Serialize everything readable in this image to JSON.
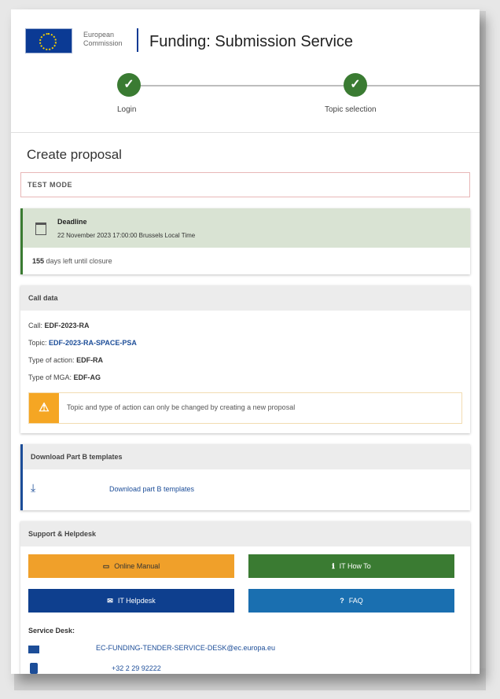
{
  "header": {
    "org_line1": "European",
    "org_line2": "Commission",
    "app_title": "Funding: Submission Service"
  },
  "stepper": {
    "steps": [
      {
        "label": "Login",
        "done": true
      },
      {
        "label": "Topic selection",
        "done": true
      }
    ]
  },
  "page_title": "Create proposal",
  "test_mode": "TEST MODE",
  "deadline": {
    "title": "Deadline",
    "date": "22 November 2023 17:00:00 Brussels Local Time",
    "days_count": "155",
    "days_text": " days left until closure"
  },
  "call_data": {
    "header": "Call data",
    "call_label": "Call:",
    "call_value": "EDF-2023-RA",
    "topic_label": "Topic:",
    "topic_value": "EDF-2023-RA-SPACE-PSA",
    "action_label": "Type of action:",
    "action_value": "EDF-RA",
    "mga_label": "Type of MGA:",
    "mga_value": "EDF-AG",
    "warning": "Topic and type of action can only be changed by creating a new proposal"
  },
  "download": {
    "header": "Download Part B templates",
    "link": "Download part B templates"
  },
  "support": {
    "header": "Support & Helpdesk",
    "buttons": {
      "manual": "Online Manual",
      "howto": "IT How To",
      "helpdesk": "IT Helpdesk",
      "faq": "FAQ"
    },
    "service_desk_label": "Service Desk:",
    "email": "EC-FUNDING-TENDER-SERVICE-DESK@ec.europa.eu",
    "phone": "+32 2 29 92222"
  },
  "colors": {
    "green": "#3a7b32",
    "blue": "#1c4d98",
    "orange": "#f0a02a",
    "light_blue": "#1a6fb0",
    "dark_blue": "#0e3f8e"
  }
}
